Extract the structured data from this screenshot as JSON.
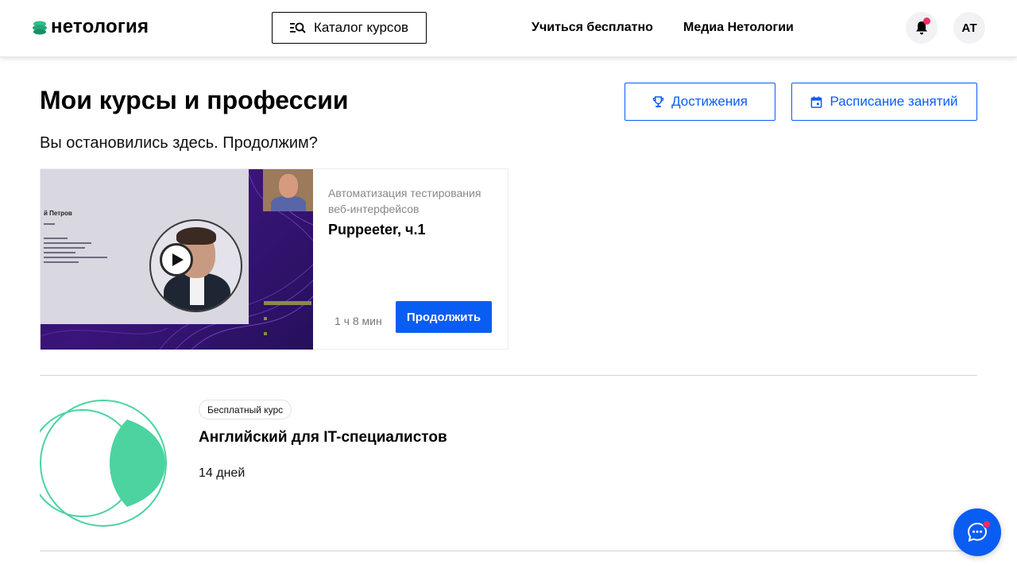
{
  "header": {
    "logo_text": "нетология",
    "catalog_label": "Каталог курсов",
    "nav": {
      "free": "Учиться бесплатно",
      "media": "Медиа Нетологии"
    },
    "avatar_initials": "АТ",
    "has_notification": true
  },
  "page": {
    "title": "Мои курсы и профессии",
    "achievements_label": "Достижения",
    "schedule_label": "Расписание занятий",
    "resume_prompt": "Вы остановились здесь. Продолжим?"
  },
  "resume_card": {
    "slide_speaker": "й Петров",
    "course_name": "Автоматизация тестирования веб-интерфейсов",
    "lesson_name": "Puppeeter, ч.1",
    "duration": "1 ч 8 мин",
    "continue_label": "Продолжить"
  },
  "course": {
    "badge": "Бесплатный курс",
    "title": "Английский для IT-специалистов",
    "duration": "14 дней"
  },
  "colors": {
    "accent": "#0a5df2",
    "notification": "#ff2b5e",
    "course_art": "#4cd3a0"
  },
  "icons": [
    "logo-icon",
    "catalog-search-icon",
    "bell-icon",
    "trophy-icon",
    "calendar-icon",
    "play-icon",
    "chat-icon"
  ]
}
